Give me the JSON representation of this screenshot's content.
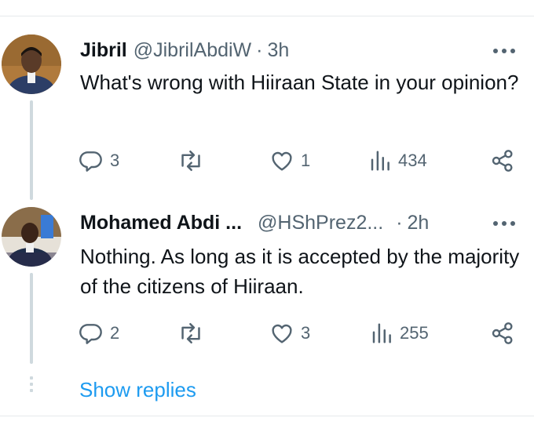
{
  "tweets": [
    {
      "name": "Jibril",
      "handle": "@JibrilAbdiW",
      "separator": "·",
      "time": "3h",
      "text": "What's wrong with Hiiraan State in your opinion?",
      "replies": "3",
      "retweets": "",
      "likes": "1",
      "views": "434"
    },
    {
      "name": "Mohamed Abdi ...",
      "handle": "@HShPrez2...",
      "separator": "·",
      "time": "2h",
      "text": "Nothing. As long as it is accepted by the majority of the citizens of Hiiraan.",
      "replies": "2",
      "retweets": "",
      "likes": "3",
      "views": "255"
    }
  ],
  "show_replies_label": "Show replies",
  "colors": {
    "link": "#1d9bf0",
    "secondary_text": "#536471",
    "thread_line": "#cfd9de"
  },
  "icons": [
    "reply-icon",
    "retweet-icon",
    "like-icon",
    "views-icon",
    "share-icon",
    "more-icon"
  ]
}
